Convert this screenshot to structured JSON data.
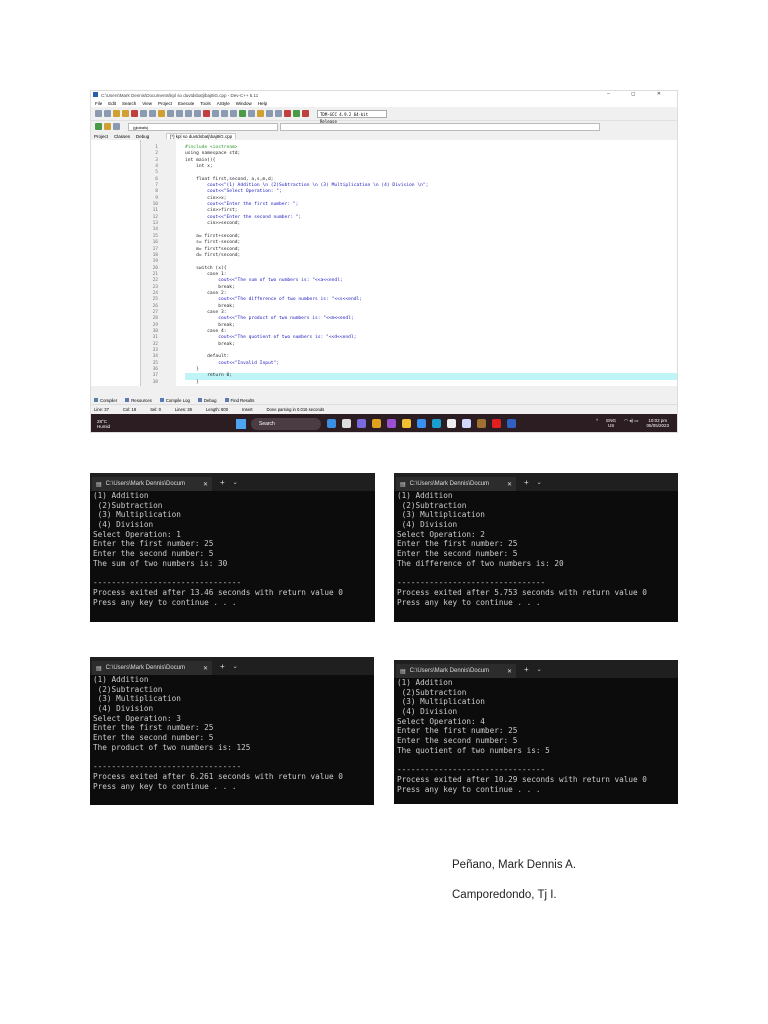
{
  "ide": {
    "title": "C:\\Users\\Mark Dennis\\Documents\\kpl so duvtdsbatj\\baj8iG.cpp - Dev-C++ 5.11",
    "window_controls": "– ◻ ✕",
    "menu": [
      "File",
      "Edit",
      "Search",
      "View",
      "Project",
      "Execute",
      "Tools",
      "AStyle",
      "Window",
      "Help"
    ],
    "compiler": "TDM-GCC 4.9.2 64-bit Release",
    "globals": "(globals)",
    "panel_tabs": [
      "Project",
      "Classes",
      "Debug"
    ],
    "editor_tab": "[*] kpl so duvtdsbatj\\baj8iG.cpp",
    "code": [
      "#include <iostream>",
      "using namespace std;",
      "int main(){",
      "    int x;",
      "",
      "    float first,second, a,s,m,d;",
      "        cout<<\"(1) Addition \\n (2)Subtraction \\n (3) Multiplication \\n (4) Division \\n\";",
      "        cout<<\"Select Operation: \";",
      "        cin>>x;",
      "        cout<<\"Enter the first number: \";",
      "        cin>>first;",
      "        cout<<\"Enter the second number: \";",
      "        cin>>second;",
      "",
      "    a= first+second;",
      "    s= first-second;",
      "    m= first*second;",
      "    d= first/second;",
      "",
      "    switch (x){",
      "        case 1:",
      "            cout<<\"The sum of two numbers is: \"<<a<<endl;",
      "            break;",
      "        case 2:",
      "            cout<<\"The difference of two numbers is: \"<<s<<endl;",
      "            break;",
      "        case 3:",
      "            cout<<\"The product of two numbers is: \"<<m<<endl;",
      "            break;",
      "        case 4:",
      "            cout<<\"The quotient of two numbers is: \"<<d<<endl;",
      "            break;",
      "",
      "        default:",
      "            cout<<\"Invalid Input\";",
      "    }",
      "        return 0;",
      "    }"
    ],
    "bottom_tabs": [
      "Compiler",
      "Resources",
      "Compile Log",
      "Debug",
      "Find Results"
    ],
    "status": [
      "Line: 37",
      "Col: 18",
      "Sel: 0",
      "Lines: 38",
      "Length: 800",
      "Insert",
      "Done parsing in 0.016 seconds"
    ],
    "taskbar": {
      "temp": "28°C",
      "weather": "Humid",
      "search": "Search",
      "lang": "ENG",
      "region": "US",
      "time": "10:02 pm",
      "date": "05/05/2023"
    }
  },
  "terminals": [
    {
      "title": "C:\\Users\\Mark Dennis\\Docum",
      "lines": [
        "(1) Addition",
        " (2)Subtraction",
        " (3) Multiplication",
        " (4) Division",
        "Select Operation: 1",
        "Enter the first number: 25",
        "Enter the second number: 5",
        "The sum of two numbers is: 30",
        "",
        "--------------------------------",
        "Process exited after 13.46 seconds with return value 0",
        "Press any key to continue . . ."
      ]
    },
    {
      "title": "C:\\Users\\Mark Dennis\\Docum",
      "lines": [
        "(1) Addition",
        " (2)Subtraction",
        " (3) Multiplication",
        " (4) Division",
        "Select Operation: 2",
        "Enter the first number: 25",
        "Enter the second number: 5",
        "The difference of two numbers is: 20",
        "",
        "--------------------------------",
        "Process exited after 5.753 seconds with return value 0",
        "Press any key to continue . . ."
      ]
    },
    {
      "title": "C:\\Users\\Mark Dennis\\Docum",
      "lines": [
        "(1) Addition",
        " (2)Subtraction",
        " (3) Multiplication",
        " (4) Division",
        "Select Operation: 3",
        "Enter the first number: 25",
        "Enter the second number: 5",
        "The product of two numbers is: 125",
        "",
        "--------------------------------",
        "Process exited after 6.261 seconds with return value 0",
        "Press any key to continue . . ."
      ]
    },
    {
      "title": "C:\\Users\\Mark Dennis\\Docum",
      "lines": [
        "(1) Addition",
        " (2)Subtraction",
        " (3) Multiplication",
        " (4) Division",
        "Select Operation: 4",
        "Enter the first number: 25",
        "Enter the second number: 5",
        "The quotient of two numbers is: 5",
        "",
        "--------------------------------",
        "Process exited after 10.29 seconds with return value 0",
        "Press any key to continue . . ."
      ]
    }
  ],
  "authors": [
    "Peñano, Mark Dennis A.",
    "Camporedondo, Tj I."
  ]
}
